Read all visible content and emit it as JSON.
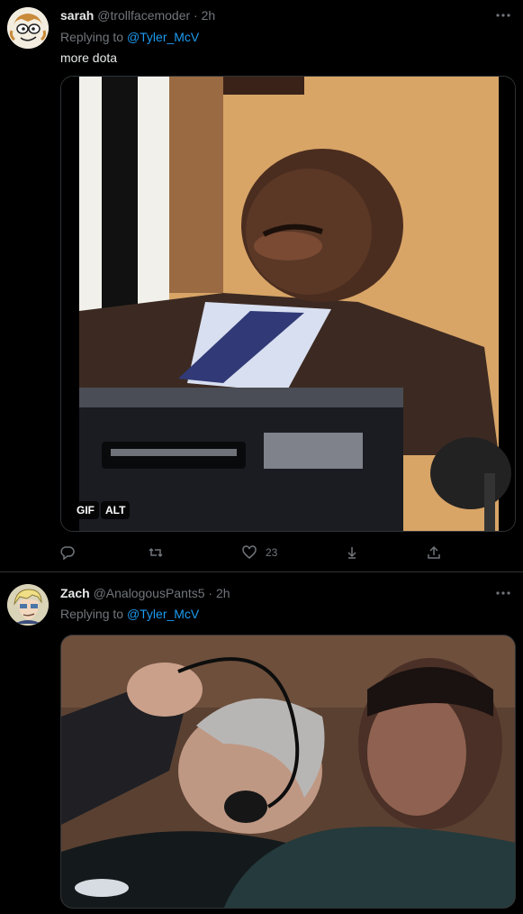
{
  "tweets": [
    {
      "display_name": "sarah",
      "handle": "@trollfacemoder",
      "separator": " · ",
      "time": "2h",
      "replying_prefix": "Replying to ",
      "replying_to": "@Tyler_McV",
      "text": "more dota",
      "media_badges": [
        "GIF",
        "ALT"
      ],
      "actions": {
        "reply_count": "",
        "retweet_count": "",
        "like_count": "23"
      },
      "icons": [
        "more-icon",
        "reply-icon",
        "retweet-icon",
        "like-icon",
        "download-icon",
        "share-icon"
      ]
    },
    {
      "display_name": "Zach",
      "handle": "@AnalogousPants5",
      "separator": " · ",
      "time": "2h",
      "replying_prefix": "Replying to ",
      "replying_to": "@Tyler_McV",
      "icons": [
        "more-icon"
      ]
    }
  ],
  "colors": {
    "background": "#000000",
    "text_primary": "#e7e9ea",
    "text_secondary": "#71767b",
    "accent": "#1d9bf0",
    "divider": "#2f3336"
  }
}
